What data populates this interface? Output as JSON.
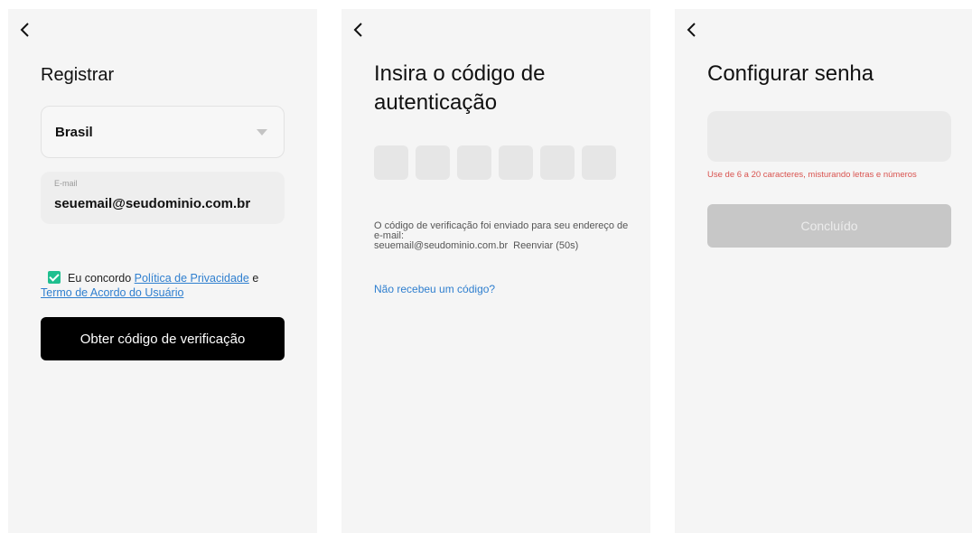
{
  "colors": {
    "panel_bg": "#f5f5f5",
    "primary_button": "#000000",
    "disabled_button": "#c7c7c7",
    "link": "#2f7fcf",
    "checkbox": "#1fbf8f",
    "error": "#d9534f"
  },
  "icons": {
    "back": "chevron-left-icon",
    "dropdown": "caret-down-icon",
    "checkbox": "checkmark-icon"
  },
  "register": {
    "title": "Registrar",
    "country": "Brasil",
    "email_label": "E-mail",
    "email_value": "seuemail@seudominio.com.br",
    "agree_prefix": "Eu concordo",
    "privacy_link": "Política de Privacidade",
    "agree_and": "e",
    "terms_link": "Termo de Acordo do Usuário",
    "get_code_button": "Obter código de verificação"
  },
  "verify": {
    "title": "Insira o código de autenticação",
    "sent_text": "O código de verificação foi enviado para seu endereço de e-mail:",
    "email": "seuemail@seudominio.com.br",
    "resend": "Reenviar (50s)",
    "no_code_link": "Não recebeu um código?"
  },
  "password": {
    "title": "Configurar senha",
    "hint": "Use de 6 a 20 caracteres, misturando letras e números",
    "done_button": "Concluído"
  }
}
